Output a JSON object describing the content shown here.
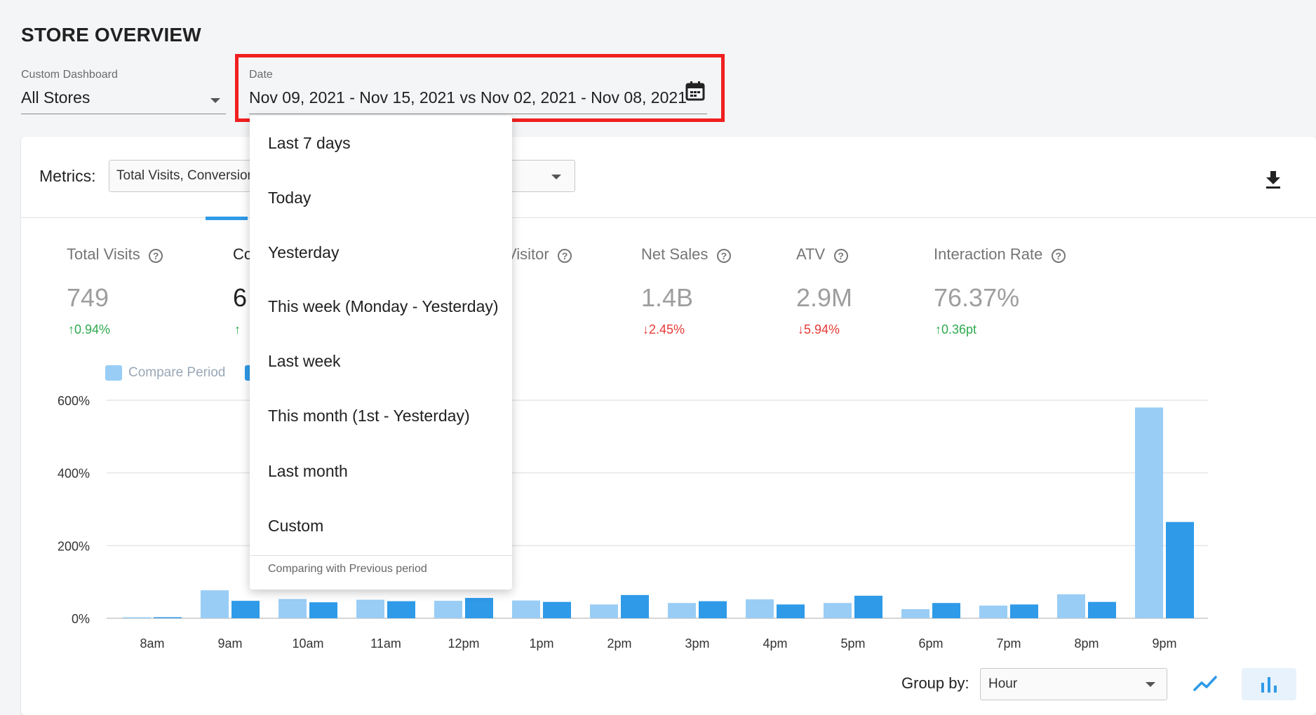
{
  "page": {
    "title": "STORE OVERVIEW"
  },
  "filters": {
    "dashboard": {
      "label": "Custom Dashboard",
      "value": "All Stores"
    },
    "date": {
      "label": "Date",
      "value": "Nov 09, 2021 - Nov 15, 2021 vs Nov 02, 2021 - Nov 08, 2021"
    }
  },
  "metrics_bar": {
    "label": "Metrics:",
    "value": "Total Visits, Conversion"
  },
  "kpis": [
    {
      "label": "Total Visits",
      "value": "749",
      "change": "0.94%",
      "direction": "up"
    },
    {
      "label": "Co",
      "value": "6",
      "change": "",
      "direction": "up"
    },
    {
      "label": "Visitor",
      "value": "",
      "change": "",
      "direction": "none"
    },
    {
      "label": "Net Sales",
      "value": "1.4B",
      "change": "2.45%",
      "direction": "down"
    },
    {
      "label": "ATV",
      "value": "2.9M",
      "change": "5.94%",
      "direction": "down"
    },
    {
      "label": "Interaction Rate",
      "value": "76.37%",
      "change": "0.36pt",
      "direction": "up"
    }
  ],
  "legend": {
    "compare": "Compare Period"
  },
  "date_presets": {
    "items": [
      "Last 7 days",
      "Today",
      "Yesterday",
      "This week (Monday - Yesterday)",
      "Last week",
      "This month (1st - Yesterday)",
      "Last month",
      "Custom"
    ],
    "footer": "Comparing with Previous period"
  },
  "group_by": {
    "label": "Group by:",
    "value": "Hour"
  },
  "colors": {
    "compare": "#99cdf5",
    "current": "#2f9ae8",
    "highlight": "#f01f1f",
    "up": "#2eaa4f",
    "down": "#e53935"
  },
  "chart_data": {
    "type": "bar",
    "categories": [
      "8am",
      "9am",
      "10am",
      "11am",
      "12pm",
      "1pm",
      "2pm",
      "3pm",
      "4pm",
      "5pm",
      "6pm",
      "7pm",
      "8pm",
      "9pm"
    ],
    "series": [
      {
        "name": "Compare Period",
        "values": [
          1,
          77,
          53,
          51,
          48,
          49,
          38,
          42,
          52,
          42,
          25,
          35,
          66,
          580
        ]
      },
      {
        "name": "",
        "values": [
          1,
          48,
          44,
          47,
          56,
          45,
          64,
          47,
          38,
          62,
          42,
          38,
          45,
          265
        ]
      }
    ],
    "ylim": [
      0,
      600
    ],
    "yticks": [
      "0%",
      "200%",
      "400%",
      "600%"
    ],
    "grid": true
  }
}
